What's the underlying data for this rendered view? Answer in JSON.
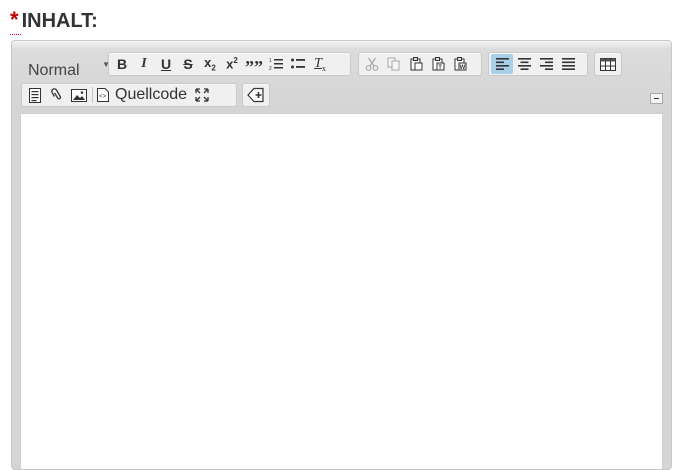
{
  "field": {
    "required_mark": "*",
    "label": "INHALT:"
  },
  "editor": {
    "toolbar": {
      "format_combo": {
        "value": "Normal"
      },
      "basicstyles": [
        {
          "name": "bold-icon",
          "title": "B"
        },
        {
          "name": "italic-icon",
          "title": "I"
        },
        {
          "name": "underline-icon",
          "title": "U"
        },
        {
          "name": "strikethrough-icon",
          "title": "S"
        },
        {
          "name": "subscript-icon",
          "title": "x2"
        },
        {
          "name": "superscript-icon",
          "title": "x2"
        },
        {
          "name": "blockquote-icon",
          "title": "quote"
        },
        {
          "name": "numbered-list-icon",
          "title": "ol"
        },
        {
          "name": "bulleted-list-icon",
          "title": "ul"
        },
        {
          "name": "remove-format-icon",
          "title": "Tx"
        }
      ],
      "clipboard": [
        "cut-icon",
        "copy-icon",
        "paste-icon",
        "paste-text-icon",
        "paste-word-icon"
      ],
      "align": [
        "align-left-icon",
        "align-center-icon",
        "align-right-icon",
        "align-justify-icon"
      ],
      "active_align": "left",
      "table_icon": "table-icon",
      "second_row": {
        "templates_icon": "templates-icon",
        "link_icon": "paperclip-icon",
        "image_icon": "image-icon",
        "source_icon": "source-icon",
        "source_label": "Quellcode",
        "maximize_icon": "maximize-icon",
        "tag_icon": "add-tag-icon"
      },
      "collapse_icon": "collapse-toolbar-icon"
    },
    "content": ""
  },
  "colors": {
    "required": "#c00000",
    "label": "#333333",
    "toolbar_bg": "#d5d5d5",
    "active_button": "#a9cfe9"
  }
}
